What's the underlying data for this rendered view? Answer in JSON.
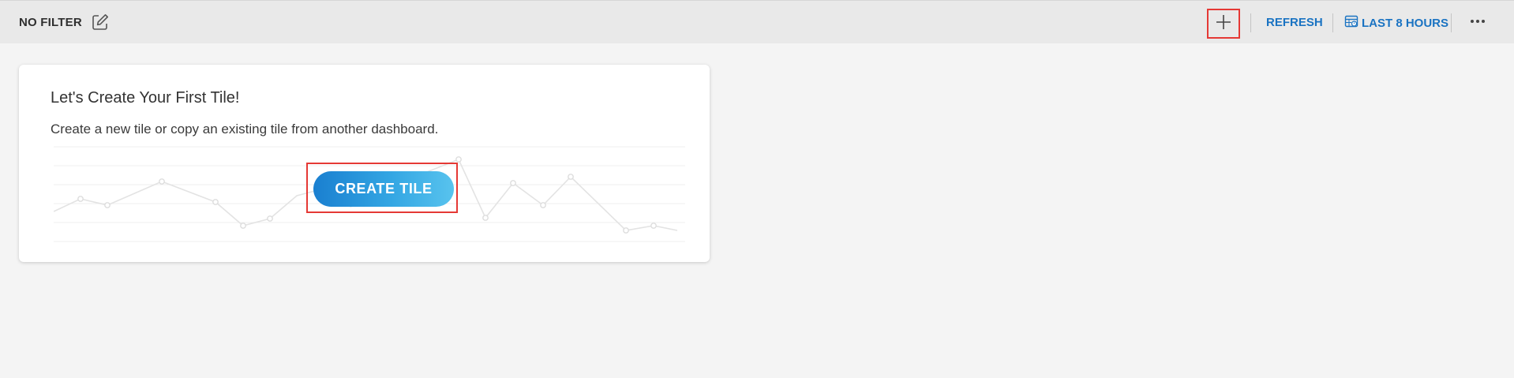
{
  "toolbar": {
    "filter_label": "NO FILTER",
    "refresh_label": "REFRESH",
    "timerange_label": "LAST 8 HOURS",
    "icons": {
      "edit": "edit-icon",
      "add": "plus-icon",
      "calendar": "calendar-icon",
      "more": "more-icon"
    },
    "accent_color": "#1a73c2",
    "highlight_color": "#e53935"
  },
  "empty_tile": {
    "title": "Let's Create Your First Tile!",
    "subtitle": "Create a new tile or copy an existing tile from another dashboard.",
    "button_label": "CREATE TILE"
  }
}
